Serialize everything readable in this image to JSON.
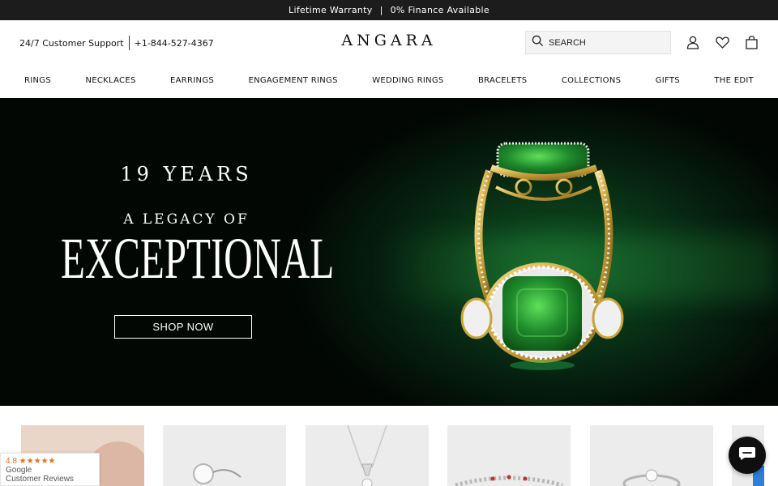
{
  "announcement": {
    "warranty": "Lifetime Warranty",
    "separator": "|",
    "finance": "0% Finance Available"
  },
  "header": {
    "support_label": "24/7 Customer Support",
    "phone": "+1-844-527-4367",
    "logo": "ANGARA",
    "search_placeholder": "SEARCH",
    "icons": [
      "search-icon",
      "user-icon",
      "heart-icon",
      "shopping-bag-icon"
    ]
  },
  "nav": {
    "items": [
      "RINGS",
      "NECKLACES",
      "EARRINGS",
      "ENGAGEMENT RINGS",
      "WEDDING RINGS",
      "BRACELETS",
      "COLLECTIONS",
      "GIFTS",
      "THE EDIT"
    ]
  },
  "hero": {
    "line1": "19 YEARS",
    "line2": "A LEGACY OF",
    "line3": "EXCEPTIONAL",
    "cta": "SHOP NOW",
    "accent": "#0f5a26"
  },
  "reviews_badge": {
    "rating": "4.8 ★★★★★",
    "source": "Google",
    "label": "Customer Reviews"
  },
  "chat": {
    "icon": "chat-bubble-icon"
  },
  "colors": {
    "topbar": "#1c1c1c",
    "gold": "#d8b24a",
    "emerald": "#1f8a2c"
  }
}
